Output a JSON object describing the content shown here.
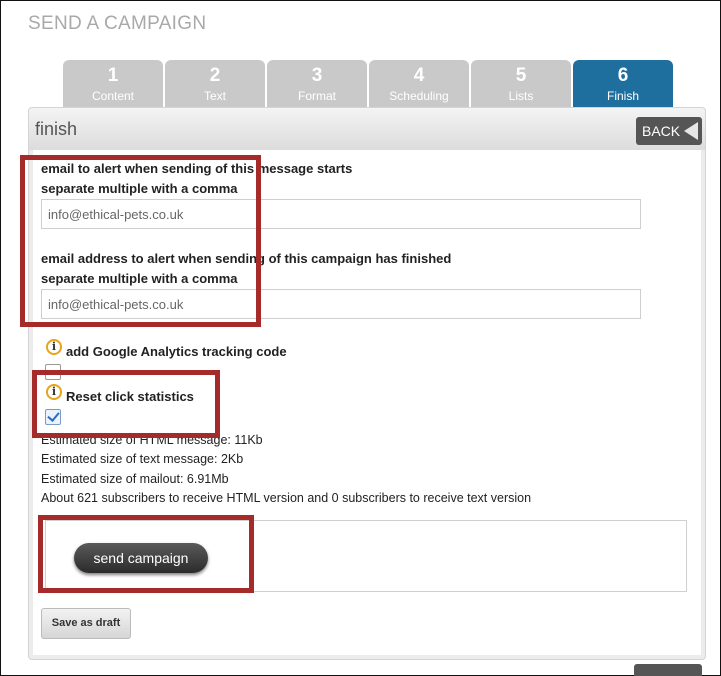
{
  "page": {
    "title": "SEND A CAMPAIGN"
  },
  "tabs": [
    {
      "num": "1",
      "label": "Content"
    },
    {
      "num": "2",
      "label": "Text"
    },
    {
      "num": "3",
      "label": "Format"
    },
    {
      "num": "4",
      "label": "Scheduling"
    },
    {
      "num": "5",
      "label": "Lists"
    },
    {
      "num": "6",
      "label": "Finish"
    }
  ],
  "active_tab": "6",
  "panel": {
    "title": "finish",
    "back_label": "BACK"
  },
  "start_alert": {
    "label": "email to alert when sending of this message starts",
    "hint": "separate multiple with a comma",
    "value": "info@ethical-pets.co.uk"
  },
  "finish_alert": {
    "label": "email address to alert when sending of this campaign has finished",
    "hint": "separate multiple with a comma",
    "value": "info@ethical-pets.co.uk"
  },
  "analytics": {
    "label": "add Google Analytics tracking code",
    "checked": false
  },
  "reset_stats": {
    "label": "Reset click statistics",
    "checked": true
  },
  "stats": {
    "html_size": "Estimated size of HTML message: 11Kb",
    "text_size": "Estimated size of text message: 2Kb",
    "mailout_size": "Estimated size of mailout: 6.91Mb",
    "subscribers": "About 621 subscribers to receive HTML version and 0 subscribers to receive text version"
  },
  "actions": {
    "send_label": "send campaign",
    "draft_label": "Save as draft"
  },
  "colors": {
    "highlight": "#a52a2a",
    "active_tab": "#1f6f9e",
    "inactive_tab": "#c9c9c9",
    "info_icon": "#e8a317"
  }
}
